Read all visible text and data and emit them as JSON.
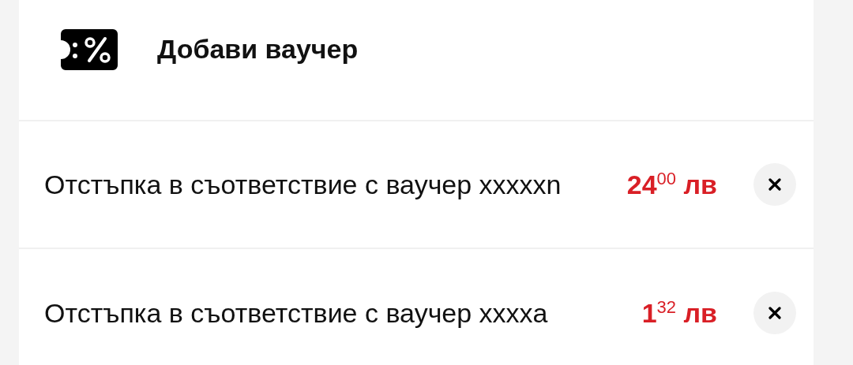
{
  "add_voucher": {
    "label": "Добави ваучер"
  },
  "discounts": [
    {
      "description": "Отстъпка в съответствие с ваучер xxxxxn",
      "amount": "24$^{00}$ лв"
    },
    {
      "description": "Отстъпка в съответствие с ваучер xxxxa",
      "amount": "1$^{32}$ лв"
    }
  ]
}
